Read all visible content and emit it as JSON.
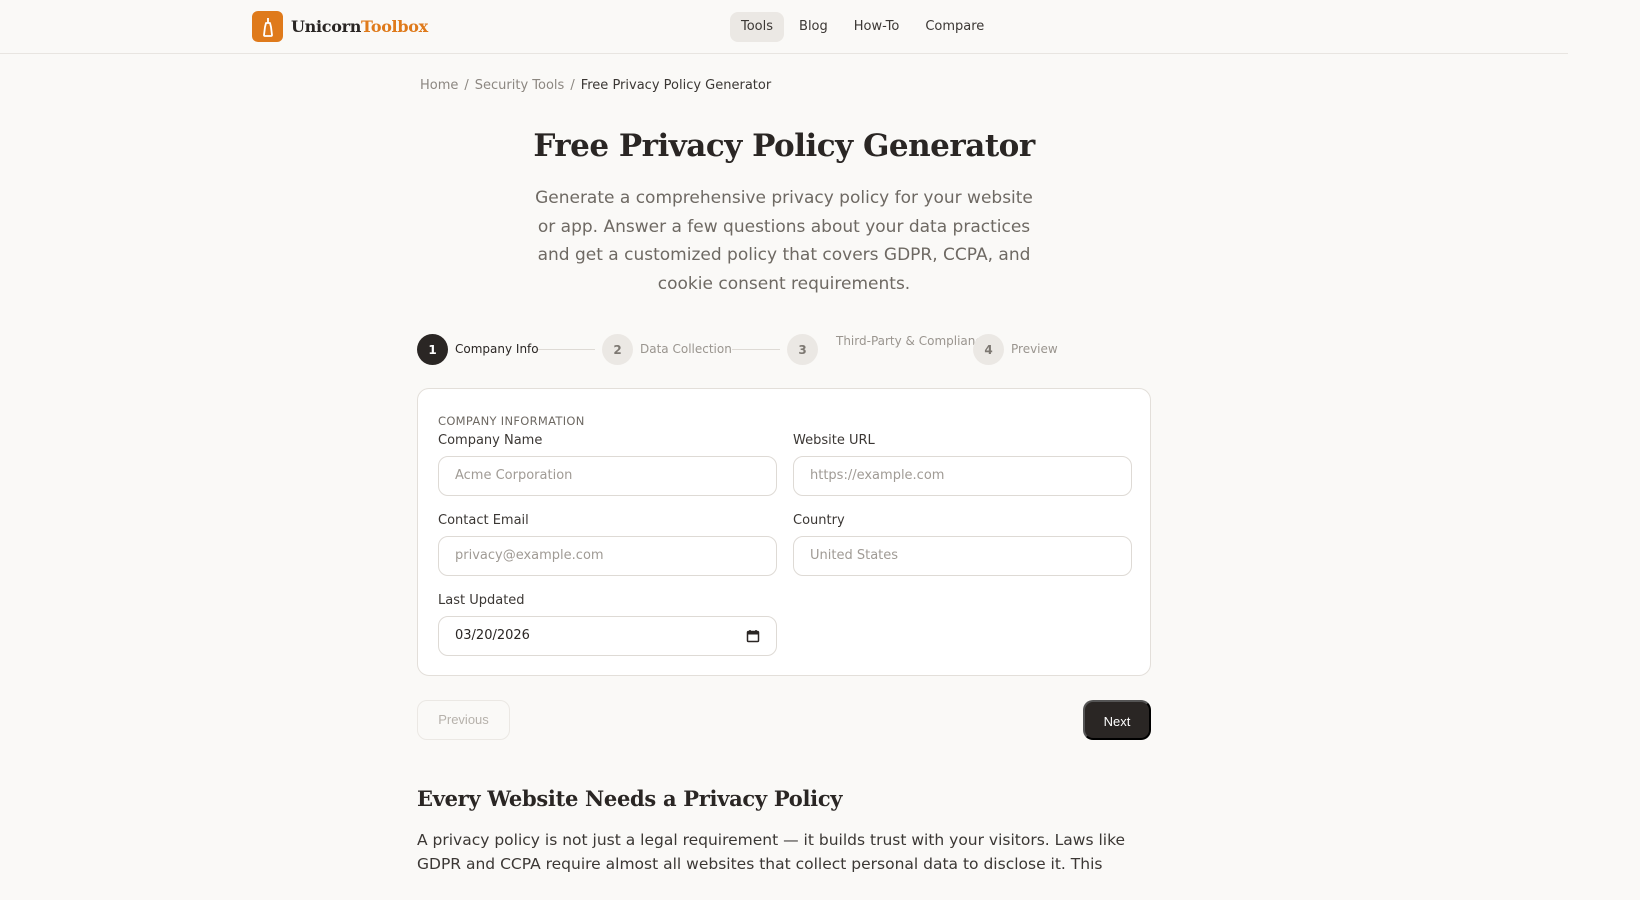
{
  "brand": {
    "name_part1": "Unicorn",
    "name_part2": "Toolbox",
    "accent": "#df7a1b",
    "icon": "bottle-icon"
  },
  "nav": {
    "items": [
      {
        "label": "Tools",
        "active": true
      },
      {
        "label": "Blog"
      },
      {
        "label": "How-To"
      },
      {
        "label": "Compare"
      }
    ]
  },
  "breadcrumb": {
    "items": [
      "Home",
      "Security Tools",
      "Free Privacy Policy Generator"
    ],
    "separator": "/"
  },
  "page": {
    "title": "Free Privacy Policy Generator",
    "subtitle": "Generate a comprehensive privacy policy for your website or app. Answer a few questions about your data practices and get a customized policy that covers GDPR, CCPA, and cookie consent requirements."
  },
  "stepper": {
    "steps": [
      {
        "number": "1",
        "label": "Company Info",
        "active": true
      },
      {
        "number": "2",
        "label": "Data Collection"
      },
      {
        "number": "3",
        "label": "Third-Party & Compliance"
      },
      {
        "number": "4",
        "label": "Preview"
      }
    ]
  },
  "form": {
    "section_label": "COMPANY INFORMATION",
    "company_name": {
      "label": "Company Name",
      "placeholder": "Acme Corporation"
    },
    "website_url": {
      "label": "Website URL",
      "placeholder": "https://example.com"
    },
    "contact_email": {
      "label": "Contact Email",
      "placeholder": "privacy@example.com"
    },
    "country": {
      "label": "Country",
      "placeholder": "United States"
    },
    "last_updated": {
      "label": "Last Updated",
      "value": "03/20/2026",
      "icon": "calendar-icon"
    }
  },
  "actions": {
    "previous": "Previous",
    "next": "Next"
  },
  "content": {
    "heading": "Every Website Needs a Privacy Policy",
    "body": "A privacy policy is not just a legal requirement — it builds trust with your visitors. Laws like GDPR and CCPA require almost all websites that collect personal data to disclose it. This"
  }
}
